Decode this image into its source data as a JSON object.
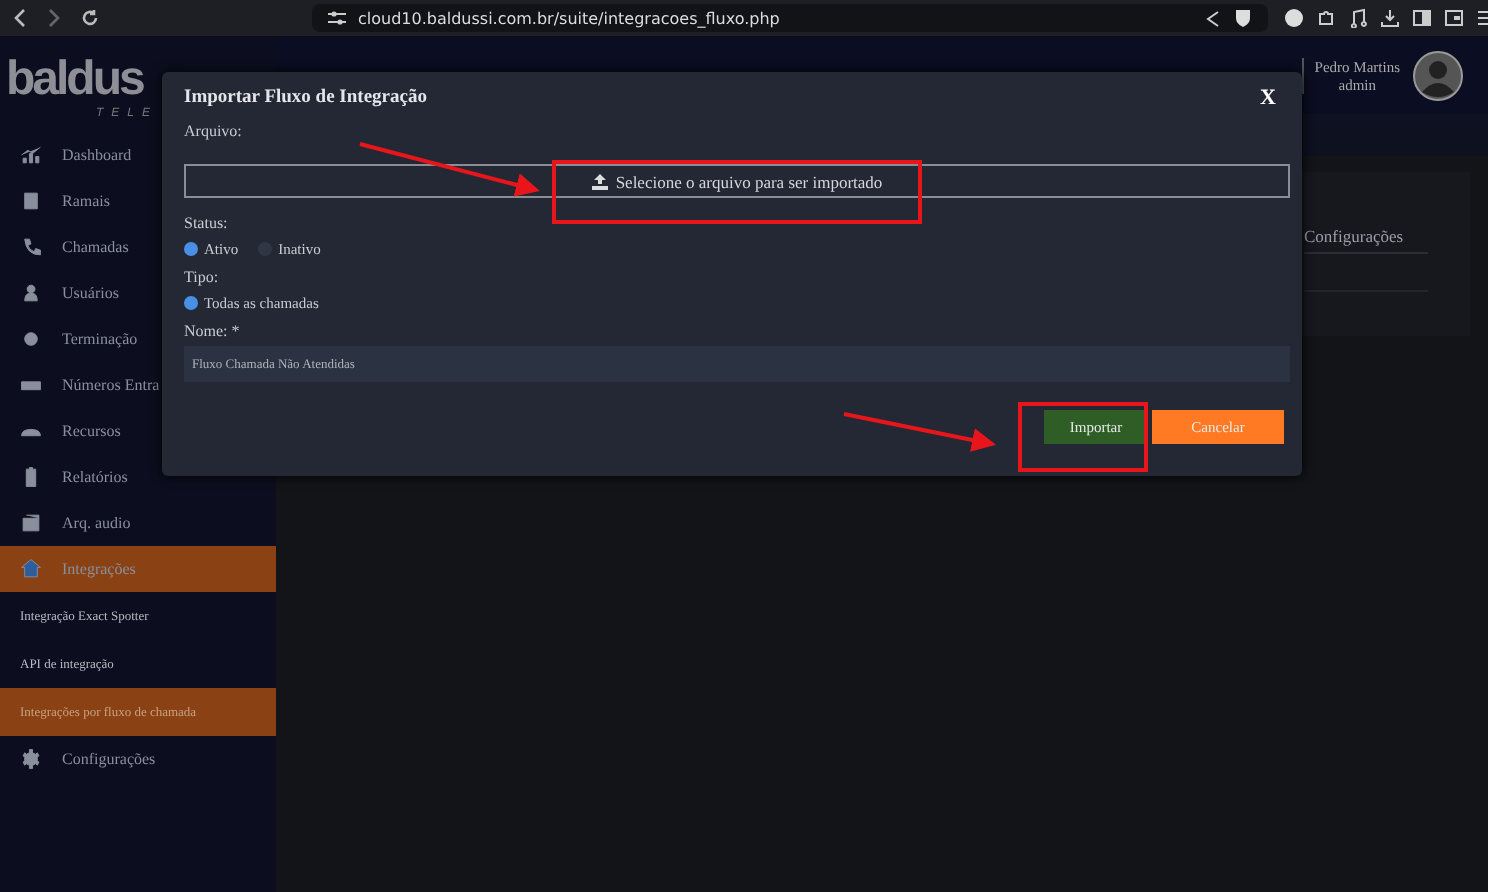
{
  "browser": {
    "url": "cloud10.baldussi.com.br/suite/integracoes_fluxo.php"
  },
  "logo": {
    "name": "baldus",
    "tagline": "TELE"
  },
  "user": {
    "name": "Pedro Martins",
    "role": "admin"
  },
  "sidebar": {
    "items": [
      {
        "label": "Dashboard",
        "selected": false
      },
      {
        "label": "Ramais",
        "selected": false
      },
      {
        "label": "Chamadas",
        "selected": false
      },
      {
        "label": "Usuários",
        "selected": false
      },
      {
        "label": "Terminação",
        "selected": false
      },
      {
        "label": "Números Entra",
        "selected": false
      },
      {
        "label": "Recursos",
        "selected": false
      },
      {
        "label": "Relatórios",
        "selected": false
      },
      {
        "label": "Arq. audio",
        "selected": false
      },
      {
        "label": "Integrações",
        "selected": true,
        "children": [
          {
            "label": "Integração Exact Spotter",
            "selected": false
          },
          {
            "label": "API de integração",
            "selected": false
          },
          {
            "label": "Integrações por fluxo de chamada",
            "selected": true
          }
        ]
      },
      {
        "label": "Configurações",
        "selected": false
      }
    ]
  },
  "background_panel": {
    "tab": "Configurações"
  },
  "modal": {
    "title": "Importar Fluxo de Integração",
    "close": "X",
    "file_label": "Arquivo:",
    "file_button": "Selecione o arquivo para ser importado",
    "status_label": "Status:",
    "status_options": [
      {
        "label": "Ativo",
        "selected": true
      },
      {
        "label": "Inativo",
        "selected": false
      }
    ],
    "type_label": "Tipo:",
    "type_options": [
      {
        "label": "Todas as chamadas",
        "selected": true
      }
    ],
    "name_label": "Nome: *",
    "name_value": "Fluxo Chamada Não Atendidas",
    "buttons": [
      {
        "label": "Importar",
        "kind": "primary"
      },
      {
        "label": "Cancelar",
        "kind": "cancel"
      }
    ]
  }
}
